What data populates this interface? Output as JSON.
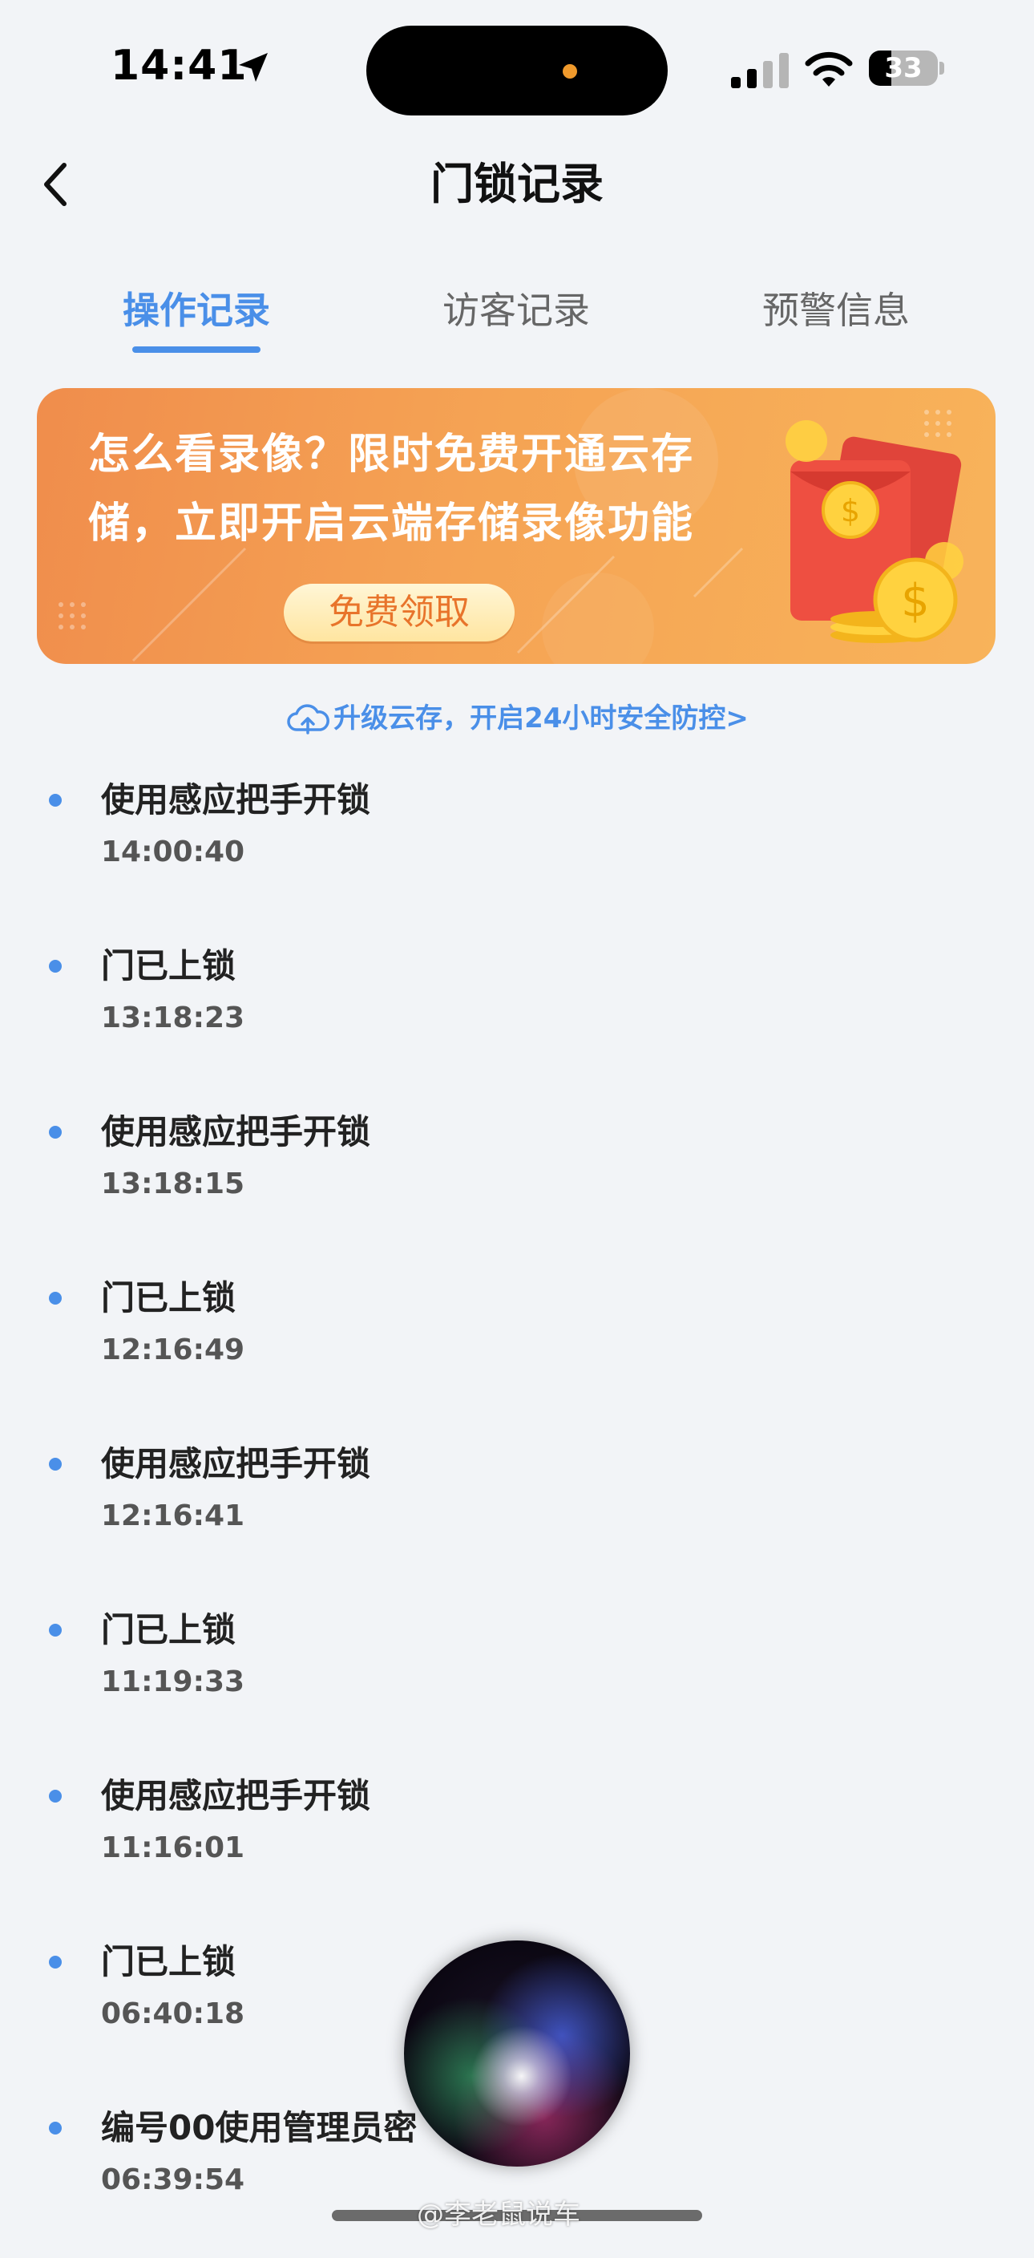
{
  "status_bar": {
    "time": "14:41",
    "battery": "33",
    "battery_level": 0.33
  },
  "header": {
    "title": "门锁记录"
  },
  "tabs": [
    {
      "label": "操作记录",
      "active": true
    },
    {
      "label": "访客记录",
      "active": false
    },
    {
      "label": "预警信息",
      "active": false
    }
  ],
  "promo": {
    "line1": "怎么看录像？限时免费开通云存",
    "line2": "储，立即开启云端存储录像功能",
    "button": "免费领取"
  },
  "upgrade_link": "升级云存，开启24小时安全防控>",
  "records": [
    {
      "title": "使用感应把手开锁",
      "time": "14:00:40"
    },
    {
      "title": "门已上锁",
      "time": "13:18:23"
    },
    {
      "title": "使用感应把手开锁",
      "time": "13:18:15"
    },
    {
      "title": "门已上锁",
      "time": "12:16:49"
    },
    {
      "title": "使用感应把手开锁",
      "time": "12:16:41"
    },
    {
      "title": "门已上锁",
      "time": "11:19:33"
    },
    {
      "title": "使用感应把手开锁",
      "time": "11:16:01"
    },
    {
      "title": "门已上锁",
      "time": "06:40:18"
    },
    {
      "title": "编号00使用管理员密",
      "time": "06:39:54"
    }
  ],
  "watermark": "@李老鼠说车",
  "colors": {
    "accent": "#4a8fe8",
    "background": "#f2f4f7",
    "promo_orange": "#f5a354"
  }
}
